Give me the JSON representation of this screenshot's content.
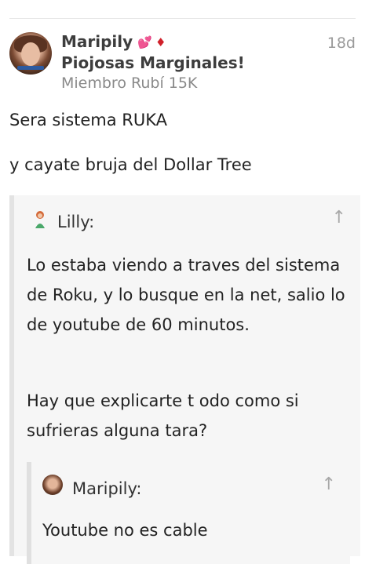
{
  "post": {
    "author": "Maripily",
    "author_badges": [
      "sparkling-heart-icon",
      "ruby-gem-icon"
    ],
    "user_title": "Piojosas Marginales!",
    "rank": "Miembro Rubí 15K",
    "age": "18d",
    "body": [
      "Sera sistema RUKA",
      "y cayate bruja del Dollar Tree"
    ]
  },
  "quote": {
    "author": "Lilly:",
    "paragraph1": "Lo estaba viendo a traves del sistema de Roku, y lo busque en la net, salio lo de youtube de 60 minutos.",
    "paragraph2": "Hay que explicarte t odo como si sufrieras alguna tara?",
    "nested": {
      "author": "Maripily:",
      "text": "Youtube no es cable"
    }
  },
  "colors": {
    "quote_bg": "#f6f6f6",
    "quote_border": "#e3e3e3",
    "badge_pink": "#e85aa8",
    "badge_red": "#d0202a"
  }
}
